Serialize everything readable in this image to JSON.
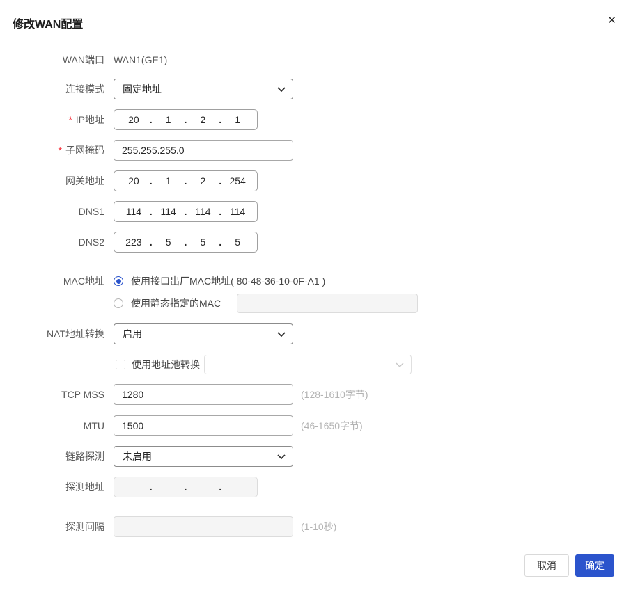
{
  "ui": {
    "octet_separator": ".",
    "required_marker": "*",
    "close_icon": "✕"
  },
  "colors": {
    "accent": "#2b54cc",
    "required": "#f5222d",
    "label": "#595959",
    "hint": "#b3b3b3"
  },
  "dialog": {
    "title": "修改WAN配置"
  },
  "form": {
    "wan_port": {
      "label": "WAN端口",
      "value": "WAN1(GE1)"
    },
    "conn_mode": {
      "label": "连接模式",
      "value": "固定地址"
    },
    "ip": {
      "label": "IP地址",
      "octets": [
        "20",
        "1",
        "2",
        "1"
      ]
    },
    "netmask": {
      "label": "子网掩码",
      "value": "255.255.255.0"
    },
    "gateway": {
      "label": "网关地址",
      "octets": [
        "20",
        "1",
        "2",
        "254"
      ]
    },
    "dns1": {
      "label": "DNS1",
      "octets": [
        "114",
        "114",
        "114",
        "114"
      ]
    },
    "dns2": {
      "label": "DNS2",
      "octets": [
        "223",
        "5",
        "5",
        "5"
      ]
    },
    "mac": {
      "label": "MAC地址",
      "factory_option": "使用接口出厂MAC地址( 80-48-36-10-0F-A1 )",
      "static_option": "使用静态指定的MAC",
      "static_value": ""
    },
    "nat": {
      "label": "NAT地址转换",
      "value": "启用"
    },
    "addr_pool": {
      "label": "使用地址池转换",
      "value": ""
    },
    "tcp_mss": {
      "label": "TCP MSS",
      "value": "1280",
      "hint": "(128-1610字节)"
    },
    "mtu": {
      "label": "MTU",
      "value": "1500",
      "hint": "(46-1650字节)"
    },
    "link_detect": {
      "label": "链路探测",
      "value": "未启用"
    },
    "detect_addr": {
      "label": "探测地址",
      "octets": [
        "",
        "",
        "",
        ""
      ]
    },
    "detect_interval": {
      "label": "探测间隔",
      "value": "",
      "hint": "(1-10秒)"
    }
  },
  "footer": {
    "cancel": "取消",
    "ok": "确定"
  }
}
